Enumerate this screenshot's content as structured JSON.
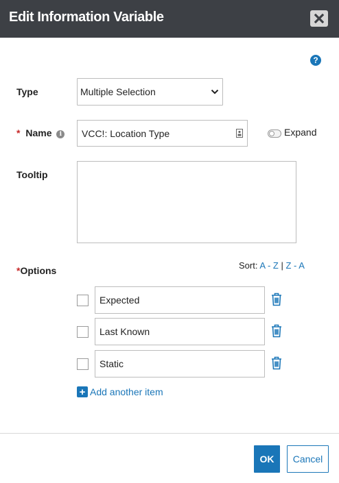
{
  "dialog": {
    "title": "Edit Information Variable"
  },
  "form": {
    "type_label": "Type",
    "type_value": "Multiple Selection",
    "name_required_mark": "*",
    "name_label": "Name",
    "name_value": "VCC!: Location Type",
    "expand_label": "Expand",
    "tooltip_label": "Tooltip",
    "tooltip_value": "",
    "options_required_mark": "*",
    "options_label": "Options",
    "sort_label": "Sort:",
    "sort_az": "A - Z",
    "sort_sep": "|",
    "sort_za": "Z - A",
    "options": [
      {
        "label": "Expected"
      },
      {
        "label": "Last Known"
      },
      {
        "label": "Static"
      }
    ],
    "add_item_label": "Add another item"
  },
  "footer": {
    "ok_label": "OK",
    "cancel_label": "Cancel"
  },
  "colors": {
    "header_bg": "#3d4045",
    "accent": "#1a76b8",
    "required": "#c62828"
  },
  "icons": {
    "close": "close-icon",
    "help": "question-circle-icon",
    "info": "info-circle-icon",
    "dropdown": "chevron-down-icon",
    "field_badge": "contact-card-icon",
    "delete": "trash-icon",
    "add": "plus-square-icon"
  }
}
